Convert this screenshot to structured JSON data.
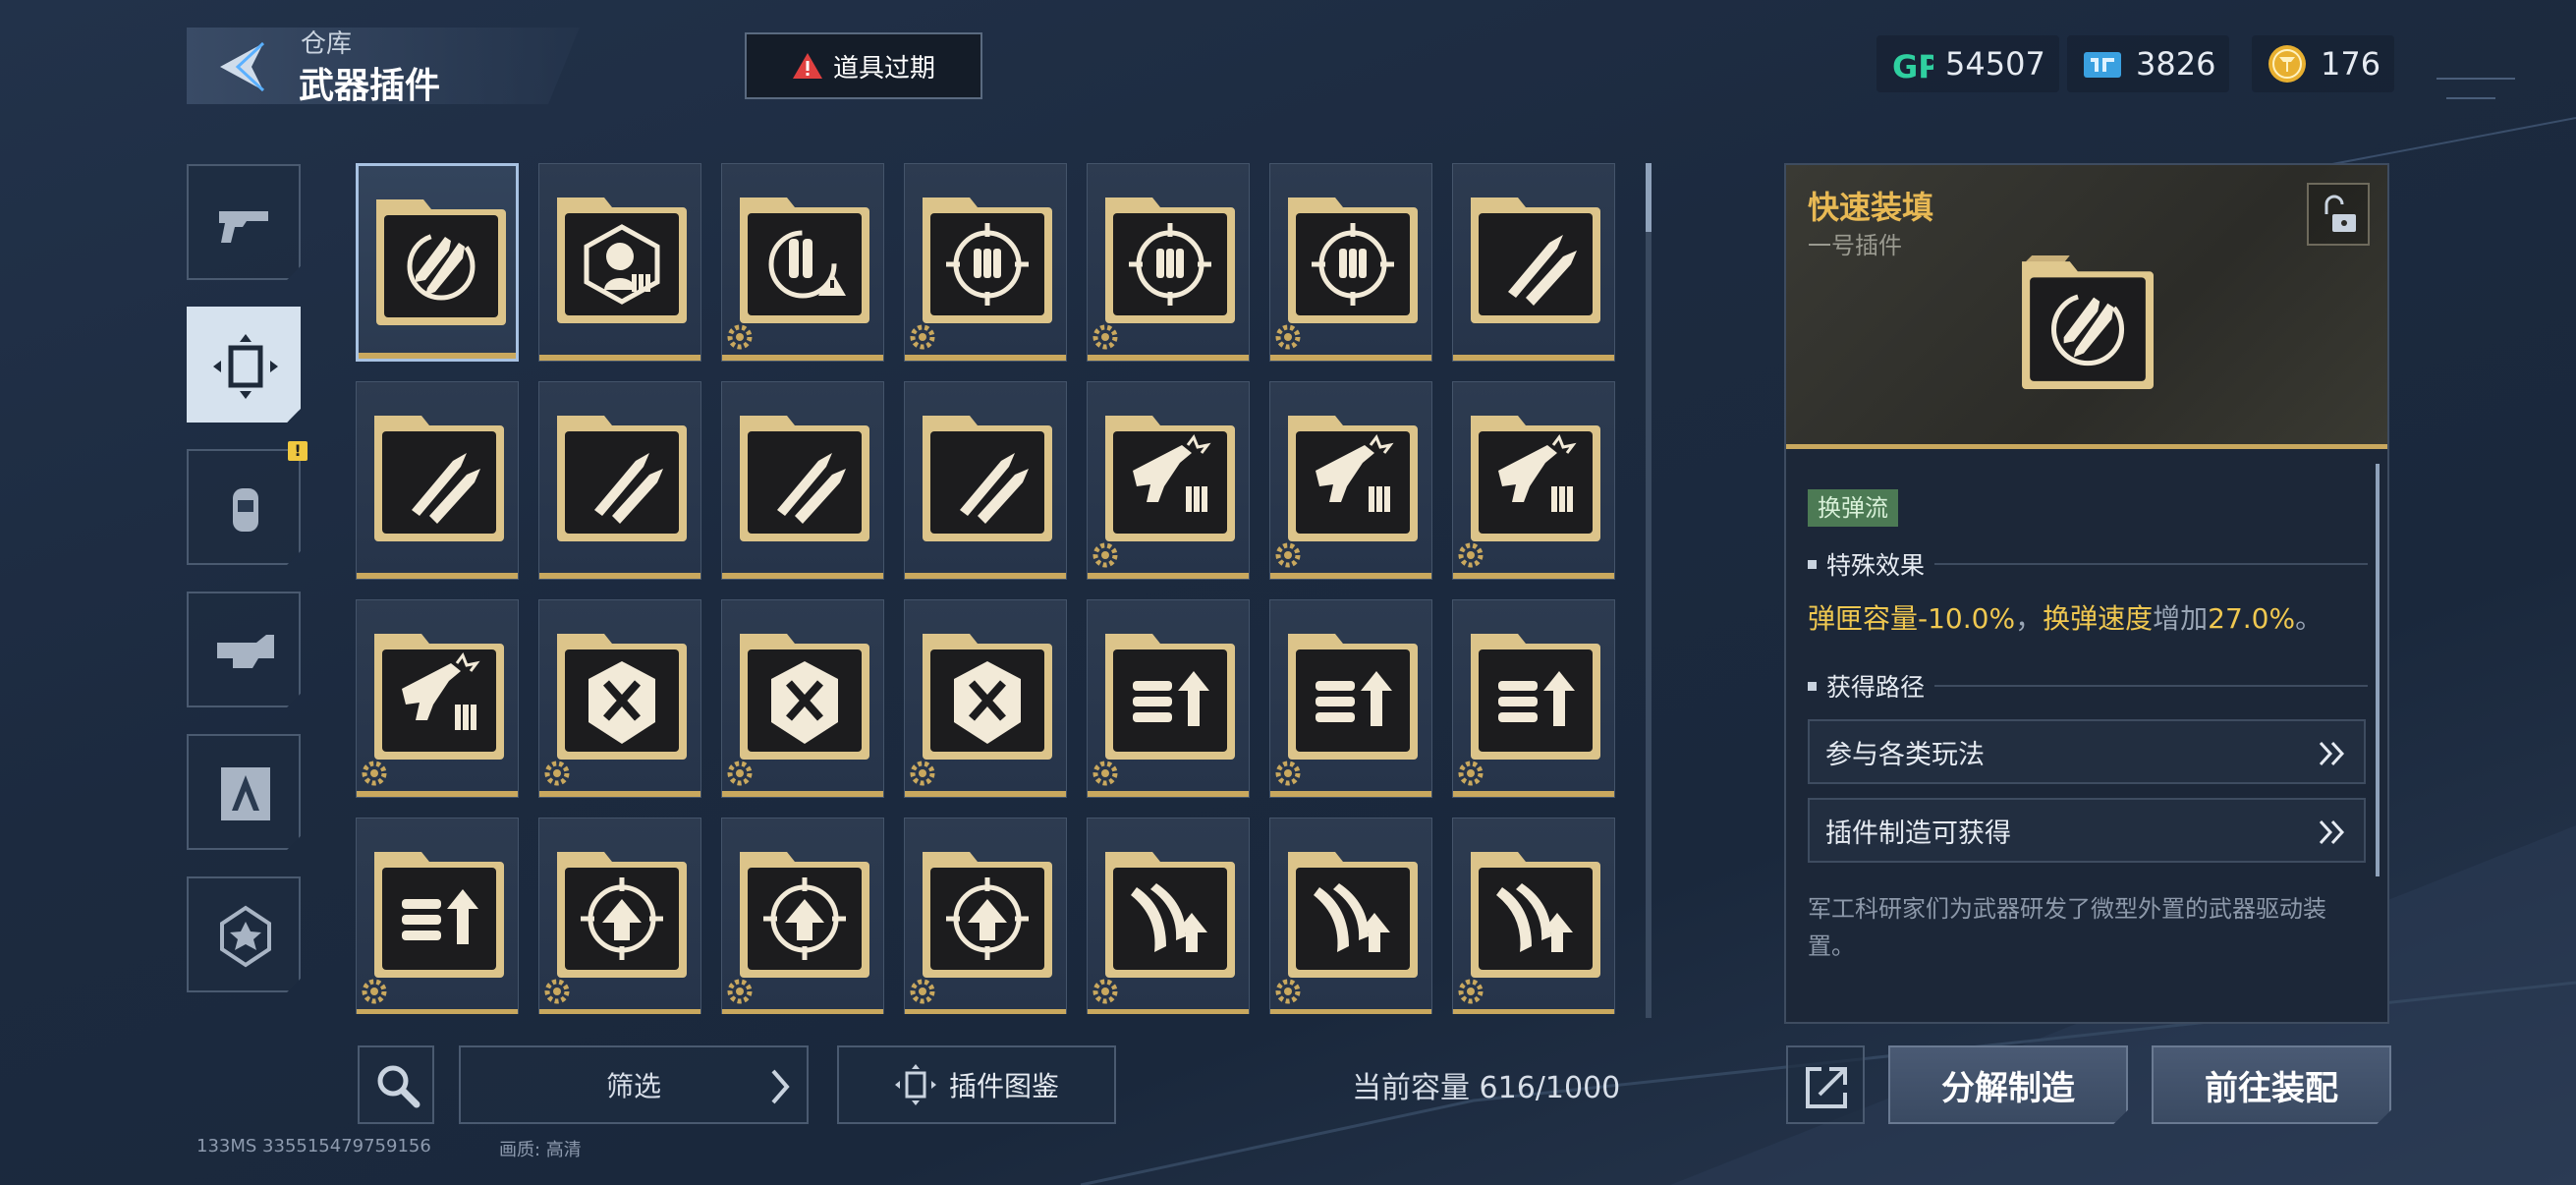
{
  "header": {
    "breadcrumb": "仓库",
    "title": "武器插件",
    "expire_button": "道具过期"
  },
  "currencies": [
    {
      "icon": "gp-icon",
      "value": "54507"
    },
    {
      "icon": "ticket-icon",
      "value": "3826"
    },
    {
      "icon": "coin-icon",
      "value": "176"
    }
  ],
  "categories": [
    {
      "icon": "pistol-icon"
    },
    {
      "icon": "plugin-frame-icon"
    },
    {
      "icon": "grenade-icon"
    },
    {
      "icon": "vehicle-icon"
    },
    {
      "icon": "character-icon"
    },
    {
      "icon": "star-badge-icon"
    }
  ],
  "plugins": [
    [
      "rocket-reload",
      "target-head",
      "ammo-warning",
      "crosshair-ammo",
      "crosshair-ammo",
      "crosshair-ammo",
      "twin-bullet"
    ],
    [
      "twin-bullet",
      "twin-bullet",
      "twin-bullet",
      "twin-bullet",
      "gun-ammo",
      "gun-ammo",
      "gun-ammo"
    ],
    [
      "gun-ammo",
      "shield-x",
      "shield-x",
      "shield-x",
      "bullets-up",
      "bullets-up",
      "bullets-up"
    ],
    [
      "bullets-up",
      "crosshair-up",
      "crosshair-up",
      "crosshair-up",
      "wing-up",
      "wing-up",
      "wing-up"
    ]
  ],
  "bottom": {
    "filter": "筛选",
    "codex": "插件图鉴",
    "capacity": "当前容量 616/1000"
  },
  "footer": {
    "info": "133MS  335515479759156",
    "quality": "画质:  高清"
  },
  "detail": {
    "name": "快速装填",
    "slot": "一号插件",
    "tag": "换弹流",
    "effect_heading": "特殊效果",
    "effect": {
      "part1": "弹匣容量",
      "part2": "-10.0%",
      "part3": "，",
      "part4": "换弹速度",
      "part5": "增加",
      "part6": "27.0%",
      "part7": "。"
    },
    "route_heading": "获得路径",
    "routes": [
      "参与各类玩法",
      "插件制造可获得"
    ],
    "description": "军工科研家们为武器研发了微型外置的武器驱动装置。"
  },
  "actions": {
    "decompose": "分解制造",
    "equip": "前往装配"
  },
  "colors": {
    "gold": "#c9a85e",
    "highlight": "#f0c850",
    "tag_green": "#4c7a54"
  }
}
